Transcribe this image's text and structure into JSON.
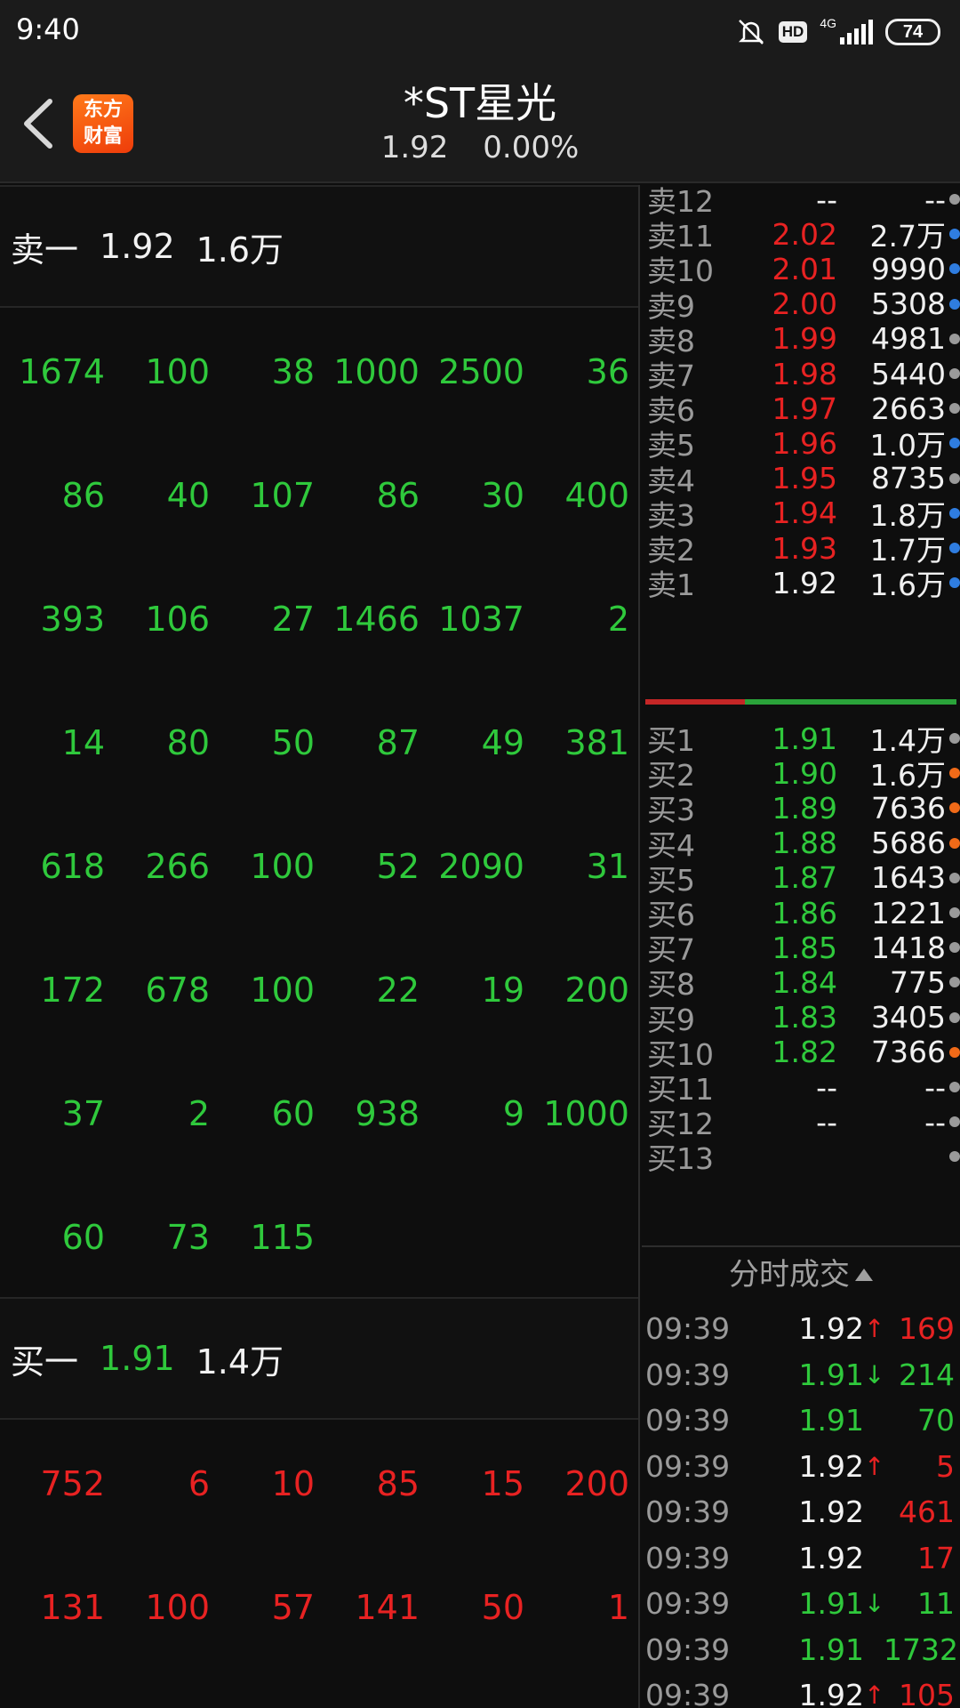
{
  "status_bar": {
    "time": "9:40",
    "hd": "HD",
    "network": "4G",
    "battery": "74"
  },
  "header": {
    "logo_line1": "东方",
    "logo_line2": "财富",
    "title": "*ST星光",
    "price": "1.92",
    "change_pct": "0.00%"
  },
  "sell_one": {
    "label": "卖一",
    "price": "1.92",
    "volume": "1.6万"
  },
  "buy_one": {
    "label": "买一",
    "price": "1.91",
    "volume": "1.4万"
  },
  "sell_queue": [
    [
      "1674",
      "100",
      "38",
      "1000",
      "2500",
      "36"
    ],
    [
      "86",
      "40",
      "107",
      "86",
      "30",
      "400"
    ],
    [
      "393",
      "106",
      "27",
      "1466",
      "1037",
      "2"
    ],
    [
      "14",
      "80",
      "50",
      "87",
      "49",
      "381"
    ],
    [
      "618",
      "266",
      "100",
      "52",
      "2090",
      "31"
    ],
    [
      "172",
      "678",
      "100",
      "22",
      "19",
      "200"
    ],
    [
      "37",
      "2",
      "60",
      "938",
      "9",
      "1000"
    ],
    [
      "60",
      "73",
      "115",
      "",
      "",
      ""
    ]
  ],
  "buy_queue": [
    [
      "752",
      "6",
      "10",
      "85",
      "15",
      "200"
    ],
    [
      "131",
      "100",
      "57",
      "141",
      "50",
      "1"
    ]
  ],
  "order_book": {
    "asks": [
      {
        "label": "卖12",
        "price": "--",
        "volume": "--",
        "dot": "gray",
        "pc": "white"
      },
      {
        "label": "卖11",
        "price": "2.02",
        "volume": "2.7万",
        "dot": "blue",
        "pc": "red"
      },
      {
        "label": "卖10",
        "price": "2.01",
        "volume": "9990",
        "dot": "blue",
        "pc": "red"
      },
      {
        "label": "卖9",
        "price": "2.00",
        "volume": "5308",
        "dot": "blue",
        "pc": "red"
      },
      {
        "label": "卖8",
        "price": "1.99",
        "volume": "4981",
        "dot": "gray",
        "pc": "red"
      },
      {
        "label": "卖7",
        "price": "1.98",
        "volume": "5440",
        "dot": "gray",
        "pc": "red"
      },
      {
        "label": "卖6",
        "price": "1.97",
        "volume": "2663",
        "dot": "gray",
        "pc": "red"
      },
      {
        "label": "卖5",
        "price": "1.96",
        "volume": "1.0万",
        "dot": "blue",
        "pc": "red"
      },
      {
        "label": "卖4",
        "price": "1.95",
        "volume": "8735",
        "dot": "gray",
        "pc": "red"
      },
      {
        "label": "卖3",
        "price": "1.94",
        "volume": "1.8万",
        "dot": "blue",
        "pc": "red"
      },
      {
        "label": "卖2",
        "price": "1.93",
        "volume": "1.7万",
        "dot": "blue",
        "pc": "red"
      },
      {
        "label": "卖1",
        "price": "1.92",
        "volume": "1.6万",
        "dot": "blue",
        "pc": "white"
      }
    ],
    "bids": [
      {
        "label": "买1",
        "price": "1.91",
        "volume": "1.4万",
        "dot": "gray",
        "pc": "green"
      },
      {
        "label": "买2",
        "price": "1.90",
        "volume": "1.6万",
        "dot": "orange",
        "pc": "green"
      },
      {
        "label": "买3",
        "price": "1.89",
        "volume": "7636",
        "dot": "orange",
        "pc": "green"
      },
      {
        "label": "买4",
        "price": "1.88",
        "volume": "5686",
        "dot": "orange",
        "pc": "green"
      },
      {
        "label": "买5",
        "price": "1.87",
        "volume": "1643",
        "dot": "gray",
        "pc": "green"
      },
      {
        "label": "买6",
        "price": "1.86",
        "volume": "1221",
        "dot": "gray",
        "pc": "green"
      },
      {
        "label": "买7",
        "price": "1.85",
        "volume": "1418",
        "dot": "gray",
        "pc": "green"
      },
      {
        "label": "买8",
        "price": "1.84",
        "volume": "775",
        "dot": "gray",
        "pc": "green"
      },
      {
        "label": "买9",
        "price": "1.83",
        "volume": "3405",
        "dot": "gray",
        "pc": "green"
      },
      {
        "label": "买10",
        "price": "1.82",
        "volume": "7366",
        "dot": "orange",
        "pc": "green"
      },
      {
        "label": "买11",
        "price": "--",
        "volume": "--",
        "dot": "gray",
        "pc": "white"
      },
      {
        "label": "买12",
        "price": "--",
        "volume": "--",
        "dot": "gray",
        "pc": "white"
      },
      {
        "label": "买13",
        "price": "",
        "volume": "",
        "dot": "gray",
        "pc": "white"
      }
    ]
  },
  "trades": {
    "title": "分时成交",
    "rows": [
      {
        "time": "09:39",
        "price": "1.92",
        "arrow": "↑",
        "volume": "169",
        "pc": "white",
        "ac": "red",
        "vc": "red"
      },
      {
        "time": "09:39",
        "price": "1.91",
        "arrow": "↓",
        "volume": "214",
        "pc": "green",
        "ac": "green",
        "vc": "green"
      },
      {
        "time": "09:39",
        "price": "1.91",
        "arrow": "",
        "volume": "70",
        "pc": "green",
        "ac": "green",
        "vc": "green"
      },
      {
        "time": "09:39",
        "price": "1.92",
        "arrow": "↑",
        "volume": "5",
        "pc": "white",
        "ac": "red",
        "vc": "red"
      },
      {
        "time": "09:39",
        "price": "1.92",
        "arrow": "",
        "volume": "461",
        "pc": "white",
        "ac": "red",
        "vc": "red"
      },
      {
        "time": "09:39",
        "price": "1.92",
        "arrow": "",
        "volume": "17",
        "pc": "white",
        "ac": "red",
        "vc": "red"
      },
      {
        "time": "09:39",
        "price": "1.91",
        "arrow": "↓",
        "volume": "11",
        "pc": "green",
        "ac": "green",
        "vc": "green"
      },
      {
        "time": "09:39",
        "price": "1.91",
        "arrow": "",
        "volume": "1732",
        "pc": "green",
        "ac": "green",
        "vc": "green"
      },
      {
        "time": "09:39",
        "price": "1.92",
        "arrow": "↑",
        "volume": "105",
        "pc": "white",
        "ac": "red",
        "vc": "red"
      }
    ]
  }
}
